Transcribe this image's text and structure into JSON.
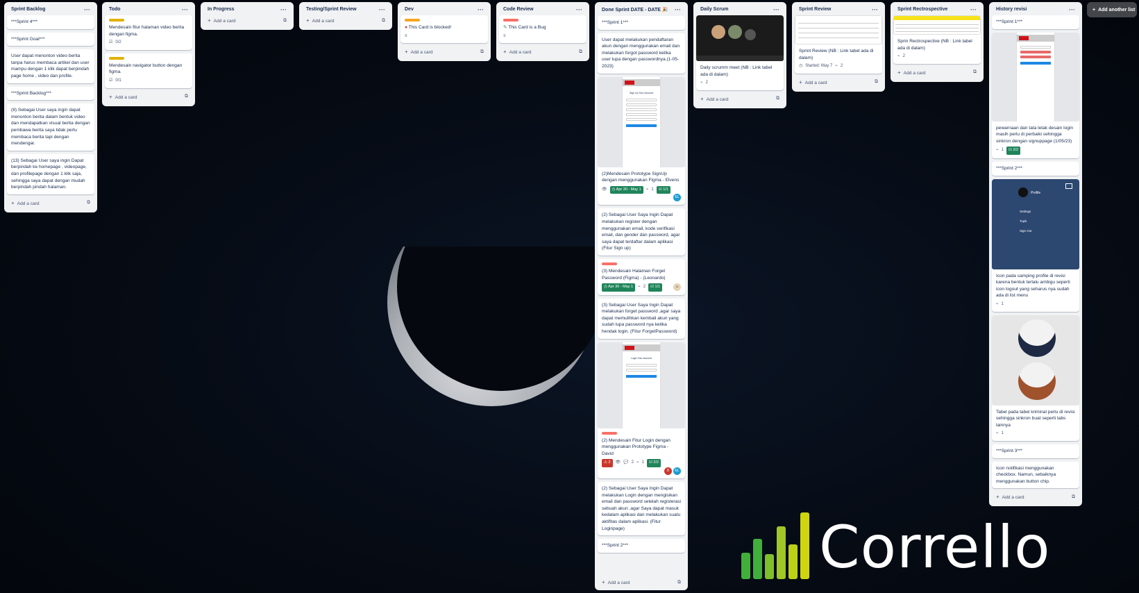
{
  "board": {
    "add_list_label": "Add another list",
    "add_card_label": "Add a card",
    "colors": {
      "green": "#1f845a",
      "yellow": "#e2b203",
      "orange": "#f5a623",
      "red": "#f87168",
      "brand_yellow": "#cfd60d",
      "brand_green": "#40b03b"
    }
  },
  "lists": {
    "sprint_backlog": {
      "title": "Sprint Backlog",
      "cards": [
        "***Sprint 4***",
        "***Sprint Goal***",
        "User dapat menonton video berita tanpa harus membaca artikel dan user mampu dengan 1 klik dapat berpindah page home , video dan profile.",
        "***Sprint Backlog***",
        "(8) Sebagai User saya ingin dapat menonton berita dalam bentuk video dan mendapatkan visual berita dengan pembawa berita saya tidak perlu membaca berita tapi dengan mendengar.",
        "(13) Sebagai User saya ingin Dapat berpindah ke homepage , videopage, dan profilepage dengan 1 klik saja, sehingga saya dapat dengan mudah berpindah pindah halaman."
      ]
    },
    "todo": {
      "title": "Todo",
      "cards": [
        {
          "text": "Mendesain fitur halaman video berita dengan figma.",
          "checklist": "0/2"
        },
        {
          "text": "Mendesain navigator button dengan figma.",
          "checklist": "0/1"
        }
      ]
    },
    "in_progress": {
      "title": "In Progress"
    },
    "testing": {
      "title": "Testing/Sprint Review"
    },
    "dev": {
      "title": "Dev",
      "cards": [
        {
          "text": "This Card is blocked!"
        }
      ]
    },
    "code_review": {
      "title": "Code Review",
      "cards": [
        {
          "text": "This Card is a Bug"
        }
      ]
    },
    "done": {
      "title": "Done Sprint DATE - DATE 🎉",
      "cards": [
        {
          "text": "***Sprint 1***"
        },
        {
          "text": "User dapat melakukan pendaftaran akun dengan menggunakan email dan melakukan forgot password ketika user lupa dengan passwordnya.(1-05-2023)"
        },
        {
          "text": "(2)Mendesain Prototype SignUp dengan menggunakan Figma - Elvens",
          "mock_title": "Sign Up Your Account",
          "date": "Apr 30 - May 1",
          "attach": "1",
          "check": "1/1",
          "avatar": "EL"
        },
        {
          "text": "(2) Sebagai User Saya Ingin Dapat melakukan register dengan menggunakan email, kode verifikasi email, dan gender dan password, agar saya dapat terdaftar dalam aplikasi (Fitur Sign up)"
        },
        {
          "text": "(3) Mendesain Halaman Forget Password (Figma) - (Leonardo)",
          "date": "Apr 30 - May 1",
          "attach": "2",
          "check": "1/1"
        },
        {
          "text": "(3) Sebagai User Saya Ingin Dapat melakukan forget password ,agar saya dapat memulihkan kembali akun yang sudah lupa password nya ketika hendak login. (Fitur ForgetPassword)"
        },
        {
          "text": "(2) Mendesain Fitur Login dengan menggunakan Prototype Figma - David",
          "mock_title": "Login Your Account",
          "votes": "2",
          "comments": "2",
          "attach": "1",
          "check": "2/2",
          "avatar": "D",
          "avatar2": "EL"
        },
        {
          "text": "(2) Sebagai User Saya Ingin Dapat melakukan Login dengan mengisikan email dan password setelah registerasi sebuah akun ,agar Saya dapat masuk kedalam aplikasi dan melakukan suatu aktifitas dalam aplikasi. (Fitur Loginpage)"
        },
        {
          "text": "***Sprint 2***"
        }
      ]
    },
    "daily_scrum": {
      "title": "Daily Scrum",
      "cards": [
        {
          "text": "Daily scrumm meet (NB : Link tabel ada di dalam)",
          "attach": "2"
        }
      ]
    },
    "sprint_review": {
      "title": "Sprint Review",
      "cards": [
        {
          "text": "Sprint Review (NB : Link tabel ada di dalam)",
          "started": "Started: May 7",
          "attach": "2"
        }
      ]
    },
    "retro": {
      "title": "Sprint Rectrospective",
      "cards": [
        {
          "text": "Sprin Rectrospective (NB : Link tabel ada di dalam)",
          "attach": "2"
        }
      ]
    },
    "history": {
      "title": "History revisi",
      "cards": [
        {
          "text": "***Sprint 1***"
        },
        {
          "text": "pewarnaan dan tata letak desain login masih perlu di perbaiki sehingga sinkron dengan signuppage (1/05/23)",
          "attach": "1",
          "check": "2/2"
        },
        {
          "text": "***Sprint 2***"
        },
        {
          "text": "Icon pada samping profile di revisi karena bentuk terlalu ambigu seperti icon logout yang seharus nya sudah ada di list menu",
          "attach": "1",
          "menu": [
            "Profile",
            "Settings",
            "Topik",
            "Sign Out"
          ]
        },
        {
          "text": "Tabel pada tabel kriminal perlu di revisi sehingga sinkron buat seperti tabs lainnya",
          "attach": "1"
        },
        {
          "text": "***Sprint 3***"
        },
        {
          "text": "Icon notifikasi menggunakan checkbox. Namun, sebaiknya menggunakan button chip."
        }
      ]
    }
  },
  "watermark": {
    "text": "Corrello"
  }
}
